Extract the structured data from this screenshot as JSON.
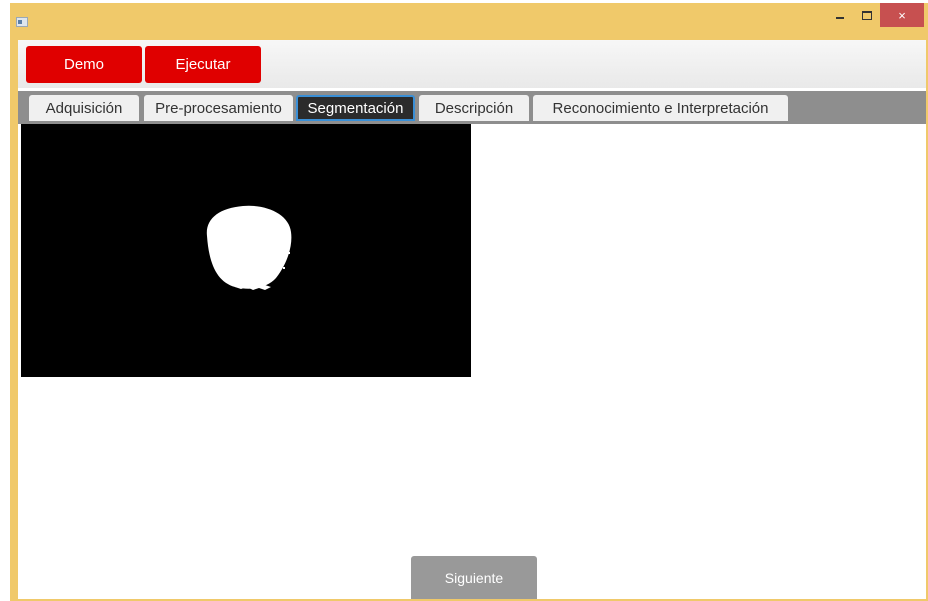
{
  "window": {
    "title": "",
    "controls": {
      "minimize_icon": "minimize-icon",
      "maximize_icon": "maximize-icon",
      "close_label": "×"
    }
  },
  "toolbar": {
    "demo_label": "Demo",
    "execute_label": "Ejecutar",
    "accent_color": "#e00000"
  },
  "tabs": [
    {
      "label": "Adquisición",
      "selected": false
    },
    {
      "label": "Pre-procesamiento",
      "selected": false
    },
    {
      "label": "Segmentación",
      "selected": true
    },
    {
      "label": "Descripción",
      "selected": false
    },
    {
      "label": "Reconocimiento e Interpretación",
      "selected": false
    }
  ],
  "segmentation": {
    "image_description": "binary-mask"
  },
  "footer": {
    "next_label": "Siguiente"
  }
}
